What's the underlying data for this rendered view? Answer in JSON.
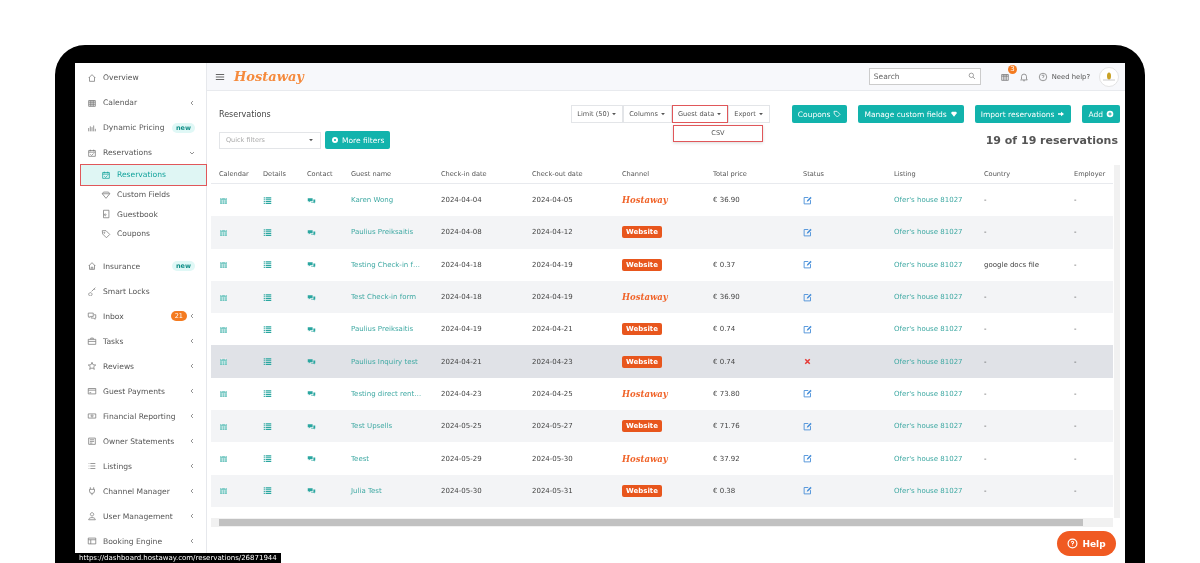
{
  "sidebar": {
    "items": [
      {
        "label": "Overview",
        "kind": "link",
        "selected": false
      },
      {
        "label": "Calendar",
        "kind": "group",
        "expanded": false,
        "selected": false
      },
      {
        "label": "Dynamic Pricing",
        "kind": "link",
        "badge": {
          "label": "new",
          "kind": "new"
        },
        "selected": false
      },
      {
        "label": "Reservations",
        "kind": "group",
        "expanded": true,
        "selected": false,
        "children": [
          {
            "label": "Reservations",
            "selected": true,
            "annotated": true
          },
          {
            "label": "Custom Fields",
            "selected": false,
            "annotated": false
          },
          {
            "label": "Guestbook",
            "selected": false,
            "annotated": false
          },
          {
            "label": "Coupons",
            "selected": false,
            "annotated": false
          }
        ]
      },
      {
        "label": "Insurance",
        "kind": "link",
        "badge": {
          "label": "new",
          "kind": "new"
        },
        "selected": false
      },
      {
        "label": "Smart Locks",
        "kind": "link",
        "selected": false
      },
      {
        "label": "Inbox",
        "kind": "group",
        "expanded": false,
        "badge": {
          "label": "21",
          "kind": "count"
        },
        "selected": false
      },
      {
        "label": "Tasks",
        "kind": "group",
        "expanded": false,
        "selected": false
      },
      {
        "label": "Reviews",
        "kind": "group",
        "expanded": false,
        "selected": false
      },
      {
        "label": "Guest Payments",
        "kind": "group",
        "expanded": false,
        "selected": false
      },
      {
        "label": "Financial Reporting",
        "kind": "group",
        "expanded": false,
        "selected": false
      },
      {
        "label": "Owner Statements",
        "kind": "group",
        "expanded": false,
        "selected": false
      },
      {
        "label": "Listings",
        "kind": "group",
        "expanded": false,
        "selected": false
      },
      {
        "label": "Channel Manager",
        "kind": "group",
        "expanded": false,
        "selected": false
      },
      {
        "label": "User Management",
        "kind": "group",
        "expanded": false,
        "selected": false
      },
      {
        "label": "Booking Engine",
        "kind": "group",
        "expanded": false,
        "selected": false
      }
    ]
  },
  "topbar": {
    "logo": "Hostaway",
    "search": {
      "placeholder": "Search"
    },
    "notification_count": "3",
    "help": "Need help?"
  },
  "page": {
    "title": "Reservations",
    "dropdowns": [
      {
        "label": "Limit (50)",
        "annotated": false
      },
      {
        "label": "Columns",
        "annotated": false
      },
      {
        "label": "Guest data",
        "annotated": true,
        "menu": [
          {
            "label": "CSV",
            "annotated": true
          }
        ]
      },
      {
        "label": "Export",
        "annotated": false
      }
    ],
    "actions": [
      {
        "label": "Coupons",
        "kind": "tag"
      },
      {
        "label": "Manage custom fields",
        "kind": "diamond"
      },
      {
        "label": "Import reservations",
        "kind": "arrow"
      },
      {
        "label": "Add",
        "kind": "plus"
      }
    ],
    "quick_filters": {
      "placeholder": "Quick filters"
    },
    "more_filters": "More filters",
    "count": "19 of 19 reservations"
  },
  "table": {
    "columns": [
      "Calendar",
      "Details",
      "Contact",
      "Guest name",
      "Check-in date",
      "Check-out date",
      "Channel",
      "Total price",
      "Status",
      "Listing",
      "Country",
      "Employer"
    ],
    "rows": [
      {
        "guest": "Karen Wong",
        "check_in": "2024-04-04",
        "check_out": "2024-04-05",
        "channel": {
          "kind": "hostaway",
          "label": "Hostaway"
        },
        "total": "€ 36.90",
        "status": {
          "kind": "edit"
        },
        "listing": "Ofer's house 81027",
        "country": "-",
        "employer": "-",
        "hovered": false
      },
      {
        "guest": "Paulius Preiksaitis",
        "check_in": "2024-04-08",
        "check_out": "2024-04-12",
        "channel": {
          "kind": "website",
          "label": "Website"
        },
        "status": {
          "kind": "edit"
        },
        "listing": "Ofer's house 81027",
        "country": "-",
        "employer": "-",
        "hovered": false
      },
      {
        "guest": "Testing Check-in f…",
        "check_in": "2024-04-18",
        "check_out": "2024-04-19",
        "channel": {
          "kind": "website",
          "label": "Website"
        },
        "total": "€ 0.37",
        "status": {
          "kind": "edit"
        },
        "listing": "Ofer's house 81027",
        "country": "google docs file",
        "employer": "-",
        "hovered": false
      },
      {
        "guest": "Test Check-in form",
        "check_in": "2024-04-18",
        "check_out": "2024-04-19",
        "channel": {
          "kind": "hostaway",
          "label": "Hostaway"
        },
        "total": "€ 36.90",
        "status": {
          "kind": "edit"
        },
        "listing": "Ofer's house 81027",
        "country": "-",
        "employer": "-",
        "hovered": false
      },
      {
        "guest": "Paulius Preiksaitis",
        "check_in": "2024-04-19",
        "check_out": "2024-04-21",
        "channel": {
          "kind": "website",
          "label": "Website"
        },
        "total": "€ 0.74",
        "status": {
          "kind": "edit"
        },
        "listing": "Ofer's house 81027",
        "country": "-",
        "employer": "-",
        "hovered": false
      },
      {
        "guest": "Paulius Inquiry test",
        "check_in": "2024-04-21",
        "check_out": "2024-04-23",
        "channel": {
          "kind": "website",
          "label": "Website"
        },
        "total": "€ 0.74",
        "status": {
          "kind": "cancelled"
        },
        "listing": "Ofer's house 81027",
        "country": "-",
        "employer": "-",
        "hovered": true
      },
      {
        "guest": "Testing direct rent…",
        "check_in": "2024-04-23",
        "check_out": "2024-04-25",
        "channel": {
          "kind": "hostaway",
          "label": "Hostaway"
        },
        "total": "€ 73.80",
        "status": {
          "kind": "edit"
        },
        "listing": "Ofer's house 81027",
        "country": "-",
        "employer": "-",
        "hovered": false
      },
      {
        "guest": "Test Upsells",
        "check_in": "2024-05-25",
        "check_out": "2024-05-27",
        "channel": {
          "kind": "website",
          "label": "Website"
        },
        "total": "€ 71.76",
        "status": {
          "kind": "edit"
        },
        "listing": "Ofer's house 81027",
        "country": "-",
        "employer": "-",
        "hovered": false
      },
      {
        "guest": "Teest",
        "check_in": "2024-05-29",
        "check_out": "2024-05-30",
        "channel": {
          "kind": "hostaway",
          "label": "Hostaway"
        },
        "total": "€ 37.92",
        "status": {
          "kind": "edit"
        },
        "listing": "Ofer's house 81027",
        "country": "-",
        "employer": "-",
        "hovered": false
      },
      {
        "guest": "Julia Test",
        "check_in": "2024-05-30",
        "check_out": "2024-05-31",
        "channel": {
          "kind": "website",
          "label": "Website"
        },
        "total": "€ 0.38",
        "status": {
          "kind": "edit"
        },
        "listing": "Ofer's house 81027",
        "country": "-",
        "employer": "-",
        "hovered": false
      }
    ]
  },
  "status_bar": {
    "url": "https://dashboard.hostaway.com/reservations/26871944"
  },
  "help_button": "Help"
}
